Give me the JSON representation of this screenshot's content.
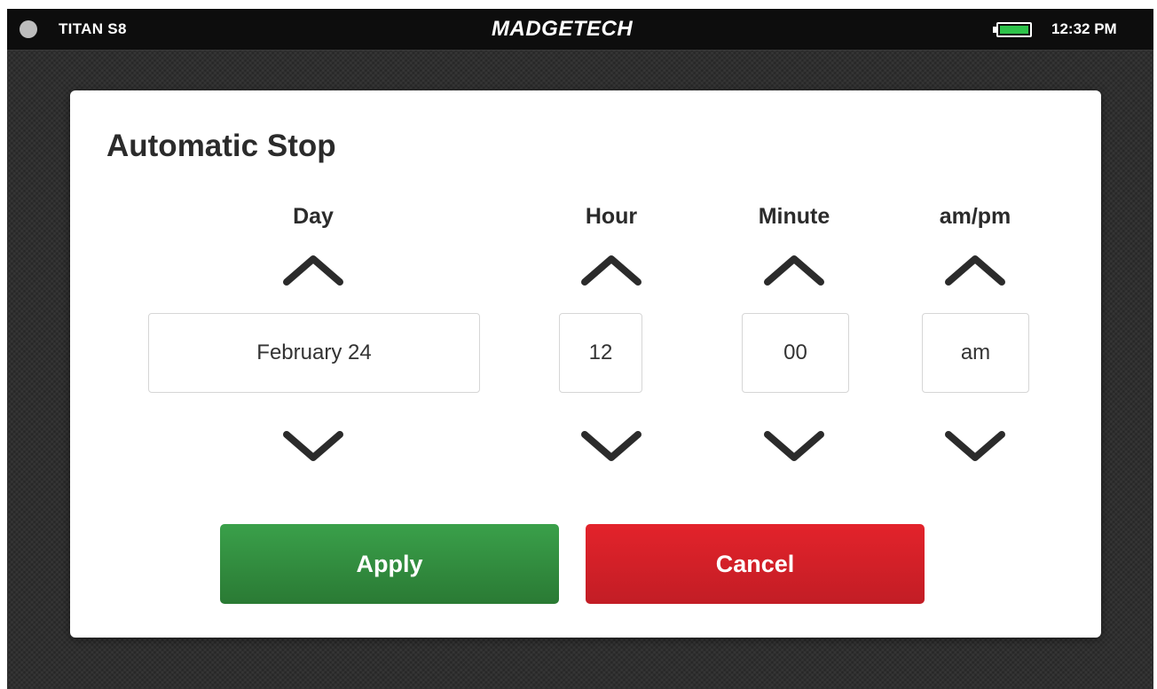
{
  "status_bar": {
    "device_name": "TITAN S8",
    "brand": "MADGETECH",
    "time": "12:32 PM",
    "battery_level": 1.0,
    "battery_color": "#2ec24a",
    "indicator_icon": "status-dot-icon"
  },
  "dialog": {
    "title": "Automatic Stop",
    "columns": {
      "day": {
        "label": "Day",
        "value": "February 24"
      },
      "hour": {
        "label": "Hour",
        "value": "12"
      },
      "minute": {
        "label": "Minute",
        "value": "00"
      },
      "ampm": {
        "label": "am/pm",
        "value": "am"
      }
    },
    "up_icon": "chevron-up-icon",
    "down_icon": "chevron-down-icon",
    "apply_label": "Apply",
    "cancel_label": "Cancel",
    "apply_color": "#2f8a3c",
    "cancel_color": "#d31f27"
  }
}
